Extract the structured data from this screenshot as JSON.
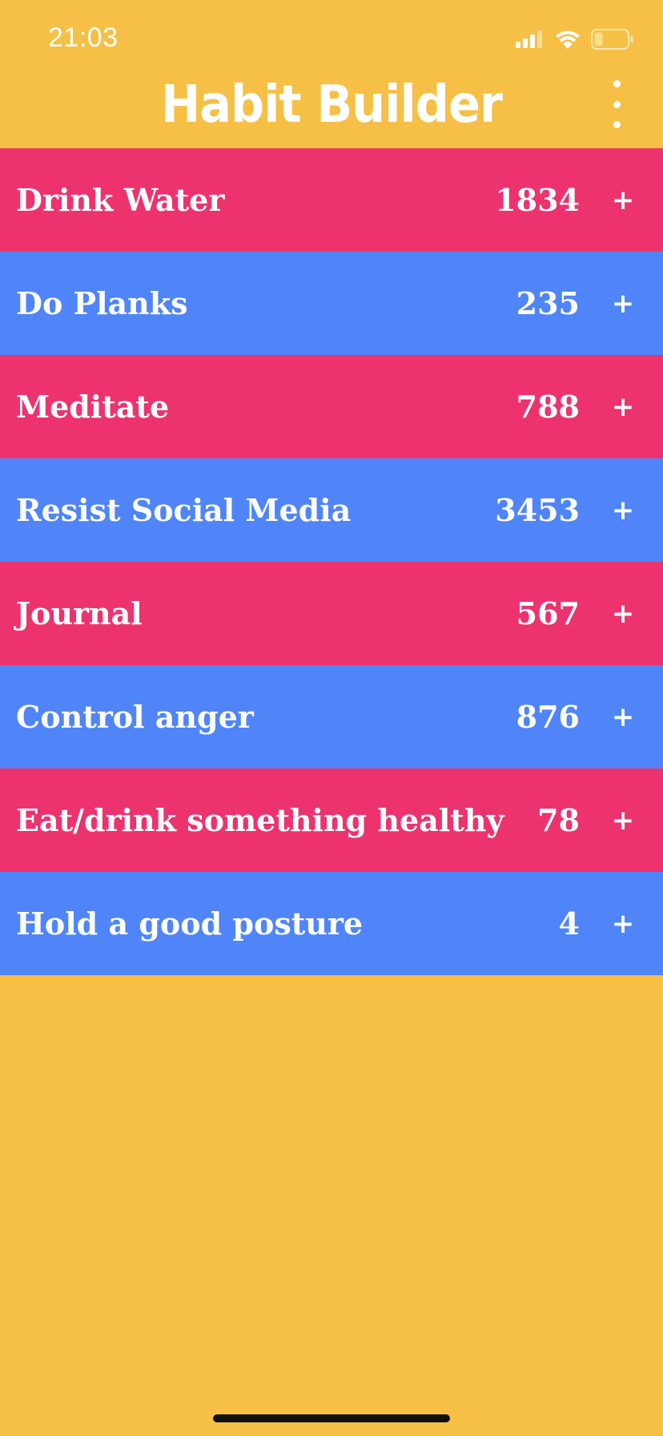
{
  "status_bar": {
    "time": "21:03"
  },
  "header": {
    "title": "Habit Builder"
  },
  "colors": {
    "background": "#F6C046",
    "row_pink": "#EC336D",
    "row_blue": "#4F85F8",
    "text": "#FFFFFF"
  },
  "habits": [
    {
      "name": "Drink Water",
      "count": "1834",
      "add_label": "+"
    },
    {
      "name": "Do Planks",
      "count": "235",
      "add_label": "+"
    },
    {
      "name": "Meditate",
      "count": "788",
      "add_label": "+"
    },
    {
      "name": "Resist Social Media",
      "count": "3453",
      "add_label": "+"
    },
    {
      "name": "Journal",
      "count": "567",
      "add_label": "+"
    },
    {
      "name": "Control anger",
      "count": "876",
      "add_label": "+"
    },
    {
      "name": "Eat/drink something healthy",
      "count": "78",
      "add_label": "+"
    },
    {
      "name": "Hold a good posture",
      "count": "4",
      "add_label": "+"
    }
  ]
}
